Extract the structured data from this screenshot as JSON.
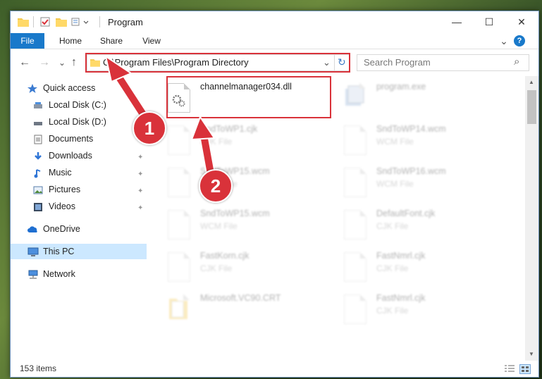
{
  "window": {
    "title": "Program",
    "minimize_glyph": "—",
    "maximize_glyph": "☐",
    "close_glyph": "✕",
    "help_glyph": "?",
    "ribbon_toggle_glyph": "⌄"
  },
  "ribbon": {
    "tabs": [
      {
        "label": "File"
      },
      {
        "label": "Home"
      },
      {
        "label": "Share"
      },
      {
        "label": "View"
      }
    ]
  },
  "address_bar": {
    "path": "C:\\Program Files\\Program Directory",
    "back_glyph": "←",
    "forward_glyph": "→",
    "recent_glyph": "⌄",
    "up_glyph": "↑",
    "dropdown_glyph": "⌄",
    "refresh_glyph": "↻"
  },
  "search": {
    "placeholder": "Search Program",
    "icon_glyph": "⌕"
  },
  "nav_pane": {
    "items": [
      {
        "label": "Quick access",
        "icon": "star-icon",
        "pinned": false
      },
      {
        "label": "Local Disk (C:)",
        "icon": "drive-icon",
        "pinned": false
      },
      {
        "label": "Local Disk (D:)",
        "icon": "drive-icon",
        "pinned": false
      },
      {
        "label": "Documents",
        "icon": "documents-icon",
        "pinned": true
      },
      {
        "label": "Downloads",
        "icon": "downloads-icon",
        "pinned": true
      },
      {
        "label": "Music",
        "icon": "music-icon",
        "pinned": true
      },
      {
        "label": "Pictures",
        "icon": "pictures-icon",
        "pinned": true
      },
      {
        "label": "Videos",
        "icon": "videos-icon",
        "pinned": true
      },
      {
        "label": "OneDrive",
        "icon": "cloud-icon",
        "pinned": false
      },
      {
        "label": "This PC",
        "icon": "computer-icon",
        "pinned": false,
        "selected": true
      },
      {
        "label": "Network",
        "icon": "network-icon",
        "pinned": false
      }
    ],
    "pin_glyph": "📌"
  },
  "files": [
    {
      "name": "channelmanager034.dll",
      "type": "",
      "highlighted": true
    },
    {
      "name": "program.exe",
      "type": ""
    },
    {
      "name": "SndToWP1.cjk",
      "type": "CJK File"
    },
    {
      "name": "SndToWP14.wcm",
      "type": "WCM File"
    },
    {
      "name": "SndToWP15.wcm",
      "type": "WCM File"
    },
    {
      "name": "SndToWP16.wcm",
      "type": "WCM File"
    },
    {
      "name": "SndToWP15.wcm",
      "type": "WCM File"
    },
    {
      "name": "DefaultFont.cjk",
      "type": "CJK File"
    },
    {
      "name": "FastKorn.cjk",
      "type": "CJK File"
    },
    {
      "name": "FastNmrl.cjk",
      "type": "CJK File"
    },
    {
      "name": "Microsoft.VC90.CRT",
      "type": ""
    },
    {
      "name": "FastNmrl.cjk",
      "type": "CJK File"
    }
  ],
  "status": {
    "item_count": "153 items"
  },
  "callouts": [
    {
      "number": "1"
    },
    {
      "number": "2"
    }
  ],
  "colors": {
    "accent": "#1979ca",
    "highlight_box": "#d9323a",
    "selected_nav": "#cce8ff"
  }
}
